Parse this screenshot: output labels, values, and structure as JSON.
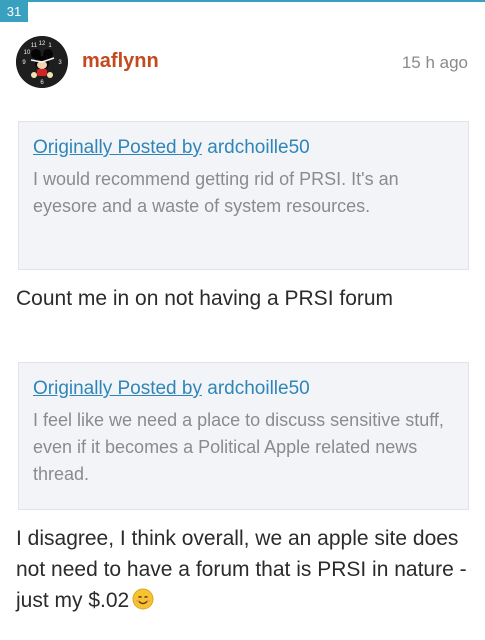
{
  "post": {
    "number": "31",
    "username": "maflynn",
    "timestamp": "15 h ago"
  },
  "quotes": [
    {
      "prefix": "Originally Posted by",
      "author": "ardchoille50",
      "text": "I would recommend getting rid of PRSI. It's an eyesore and a waste of system resources."
    },
    {
      "prefix": "Originally Posted by",
      "author": "ardchoille50",
      "text": "I feel like we need a place to discuss sensitive stuff, even if it becomes a Political Apple related news thread."
    }
  ],
  "replies": [
    "Count me in on not having a PRSI forum",
    "I disagree, I think overall, we an apple site does not need to have a forum that is PRSI in nature - just my $.02"
  ],
  "icons": {
    "avatar": "mickey-mouse-clock-avatar",
    "emoji": "smiling-face-icon"
  },
  "colors": {
    "accent": "#3aa0c0",
    "username": "#c34a1d",
    "link": "#2e86b8",
    "quote_bg": "#f3f4f7"
  }
}
